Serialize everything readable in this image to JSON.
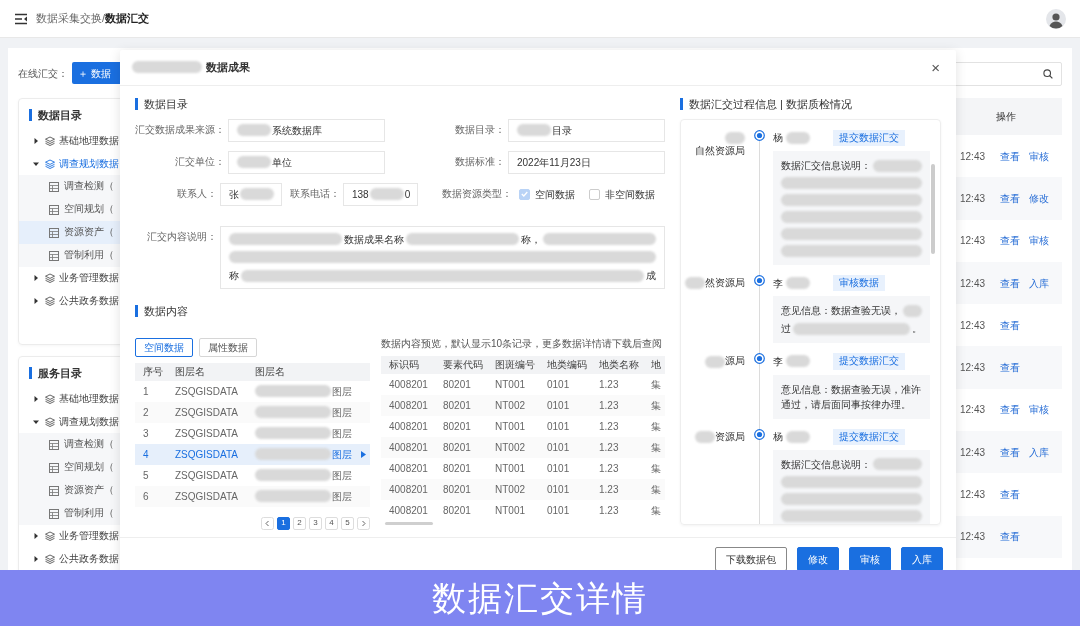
{
  "header": {
    "breadcrumb_parent": "数据采集交换/",
    "breadcrumb_current": "数据汇交"
  },
  "toolbar": {
    "label": "在线汇交：",
    "button": "＋ 数据"
  },
  "trees": [
    {
      "title": "数据目录",
      "items": [
        {
          "label": "基础地理数据",
          "expanded": false,
          "selected": false
        },
        {
          "label": "调查规划数据",
          "expanded": true,
          "selected": true,
          "children": [
            {
              "label": "调查检测（",
              "selected": false
            },
            {
              "label": "空间规划（",
              "selected": false
            },
            {
              "label": "资源资产（",
              "selected": true
            },
            {
              "label": "管制利用（",
              "selected": false
            }
          ]
        },
        {
          "label": "业务管理数据",
          "expanded": false,
          "selected": false
        },
        {
          "label": "公共政务数据",
          "expanded": false,
          "selected": false
        }
      ]
    },
    {
      "title": "服务目录",
      "items": [
        {
          "label": "基础地理数据",
          "expanded": false,
          "selected": false
        },
        {
          "label": "调查规划数据",
          "expanded": true,
          "selected": false,
          "children": [
            {
              "label": "调查检测（",
              "selected": false
            },
            {
              "label": "空间规划（",
              "selected": false
            },
            {
              "label": "资源资产（",
              "selected": false
            },
            {
              "label": "管制利用（",
              "selected": false
            }
          ]
        },
        {
          "label": "业务管理数据",
          "expanded": false,
          "selected": false
        },
        {
          "label": "公共政务数据",
          "expanded": false,
          "selected": false
        }
      ]
    }
  ],
  "table": {
    "columns": [
      "操作"
    ],
    "rows": [
      {
        "time": "12:43",
        "actions": [
          "查看",
          "审核"
        ]
      },
      {
        "time": "12:43",
        "actions": [
          "查看",
          "修改"
        ]
      },
      {
        "time": "12:43",
        "actions": [
          "查看",
          "审核"
        ]
      },
      {
        "time": "12:43",
        "actions": [
          "查看",
          "入库"
        ]
      },
      {
        "time": "12:43",
        "actions": [
          "查看"
        ]
      },
      {
        "time": "12:43",
        "actions": [
          "查看"
        ]
      },
      {
        "time": "12:43",
        "actions": [
          "查看",
          "审核"
        ]
      },
      {
        "time": "12:43",
        "actions": [
          "查看",
          "入库"
        ]
      },
      {
        "time": "12:43",
        "actions": [
          "查看"
        ]
      },
      {
        "time": "12:43",
        "actions": [
          "查看"
        ]
      }
    ]
  },
  "modal": {
    "title": [
      {
        "kind": "redacted"
      },
      "数据成果"
    ],
    "close": "×",
    "catalog_title": "数据目录",
    "form": [
      [
        {
          "label": "汇交数据成果来源：",
          "kind": "text",
          "value": [
            {
              "kind": "redacted"
            },
            "系统数据库"
          ]
        },
        {
          "label": "数据目录：",
          "kind": "text",
          "value": [
            {
              "kind": "redacted"
            },
            "目录"
          ]
        }
      ],
      [
        {
          "label": "汇交单位：",
          "kind": "text",
          "value": [
            {
              "kind": "redacted"
            },
            "单位"
          ]
        },
        {
          "label": "数据标准：",
          "kind": "text",
          "value": [
            "2022年11月23日"
          ]
        }
      ],
      [
        {
          "label": "联系人：",
          "kind": "text",
          "value": [
            "张",
            {
              "kind": "redacted"
            }
          ]
        },
        {
          "label": "联系电话：",
          "kind": "text",
          "value": [
            "138",
            {
              "kind": "redacted"
            },
            "0"
          ]
        },
        {
          "label": "数据资源类型：",
          "kind": "checkboxes",
          "options": [
            {
              "label": "空间数据",
              "checked": true
            },
            {
              "label": "非空间数据",
              "checked": false
            }
          ]
        }
      ],
      [
        {
          "label": "汇交内容说明：",
          "kind": "textarea",
          "lines": [
            [
              {
                "kind": "redacted"
              },
              "数据成果名称",
              {
                "kind": "redacted"
              },
              "称，",
              {
                "kind": "redacted"
              }
            ],
            [
              {
                "kind": "redacted"
              }
            ],
            [
              "称",
              {
                "kind": "redacted"
              },
              "成"
            ]
          ]
        }
      ]
    ],
    "content_title": "数据内容",
    "tabs": [
      {
        "label": "空间数据",
        "selected": true
      },
      {
        "label": "属性数据",
        "selected": false
      }
    ],
    "layers": {
      "columns": [
        "序号",
        "图层名",
        "图层名"
      ],
      "rows": [
        {
          "cells": [
            "1",
            "ZSQGISDATA",
            [
              {
                "kind": "redacted"
              },
              "图层"
            ]
          ],
          "selected": false
        },
        {
          "cells": [
            "2",
            "ZSQGISDATA",
            [
              {
                "kind": "redacted"
              },
              "图层"
            ]
          ],
          "selected": false
        },
        {
          "cells": [
            "3",
            "ZSQGISDATA",
            [
              {
                "kind": "redacted"
              },
              "图层"
            ]
          ],
          "selected": false
        },
        {
          "cells": [
            "4",
            "ZSQGISDATA",
            [
              {
                "kind": "redacted"
              },
              "图层"
            ]
          ],
          "selected": true
        },
        {
          "cells": [
            "5",
            "ZSQGISDATA",
            [
              {
                "kind": "redacted"
              },
              "图层"
            ]
          ],
          "selected": false
        },
        {
          "cells": [
            "6",
            "ZSQGISDATA",
            [
              {
                "kind": "redacted"
              },
              "图层"
            ]
          ],
          "selected": false
        }
      ]
    },
    "pages": [
      {
        "label": "1",
        "selected": true
      },
      {
        "label": "2",
        "selected": false
      },
      {
        "label": "3",
        "selected": false
      },
      {
        "label": "4",
        "selected": false
      },
      {
        "label": "5",
        "selected": false
      }
    ],
    "preview_note": "数据内容预览，默认显示10条记录，更多数据详情请下载后查阅",
    "records": {
      "columns": [
        "标识码",
        "要素代码",
        "图斑编号",
        "地类编码",
        "地类名称",
        "地"
      ],
      "rows": [
        [
          "4008201",
          "80201",
          "NT001",
          "0101",
          "1.23",
          "集"
        ],
        [
          "4008201",
          "80201",
          "NT002",
          "0101",
          "1.23",
          "集"
        ],
        [
          "4008201",
          "80201",
          "NT001",
          "0101",
          "1.23",
          "集"
        ],
        [
          "4008201",
          "80201",
          "NT002",
          "0101",
          "1.23",
          "集"
        ],
        [
          "4008201",
          "80201",
          "NT001",
          "0101",
          "1.23",
          "集"
        ],
        [
          "4008201",
          "80201",
          "NT002",
          "0101",
          "1.23",
          "集"
        ],
        [
          "4008201",
          "80201",
          "NT001",
          "0101",
          "1.23",
          "集"
        ]
      ]
    },
    "process_title": "数据汇交过程信息 | 数据质检情况",
    "timeline": [
      {
        "org": [
          {
            "kind": "redacted"
          },
          "自然资源局"
        ],
        "person": [
          "杨",
          {
            "kind": "redacted"
          }
        ],
        "tag": "提交数据汇交",
        "body": [
          [
            "数据汇交信息说明：",
            {
              "kind": "redacted"
            }
          ],
          [
            {
              "kind": "redacted"
            }
          ],
          [
            {
              "kind": "redacted"
            }
          ],
          [
            {
              "kind": "redacted"
            }
          ],
          [
            {
              "kind": "redacted"
            }
          ],
          [
            {
              "kind": "redacted"
            }
          ]
        ]
      },
      {
        "org": [
          {
            "kind": "redacted"
          },
          "然资源局"
        ],
        "person": [
          "李",
          {
            "kind": "redacted"
          }
        ],
        "tag": "审核数据",
        "body": [
          [
            "意见信息：数据查验无误，",
            {
              "kind": "redacted"
            }
          ],
          [
            "过",
            {
              "kind": "redacted"
            },
            "。"
          ]
        ]
      },
      {
        "org": [
          {
            "kind": "redacted"
          },
          "源局"
        ],
        "person": [
          "李",
          {
            "kind": "redacted"
          }
        ],
        "tag": "提交数据汇交",
        "body": [
          [
            "意见信息：数据查验无误，准许通过，请后面同事按律办理。"
          ]
        ]
      },
      {
        "org": [
          {
            "kind": "redacted"
          },
          "资源局"
        ],
        "person": [
          "杨",
          {
            "kind": "redacted"
          }
        ],
        "tag": "提交数据汇交",
        "body": [
          [
            "数据汇交信息说明：",
            {
              "kind": "redacted"
            }
          ],
          [
            {
              "kind": "redacted"
            }
          ],
          [
            {
              "kind": "redacted"
            }
          ],
          [
            {
              "kind": "redacted"
            }
          ]
        ]
      }
    ],
    "buttons": [
      {
        "label": "下载数据包",
        "kind": "outline"
      },
      {
        "label": "修改",
        "kind": "primary"
      },
      {
        "label": "审核",
        "kind": "primary"
      },
      {
        "label": "入库",
        "kind": "primary"
      }
    ]
  },
  "caption": "数据汇交详情"
}
